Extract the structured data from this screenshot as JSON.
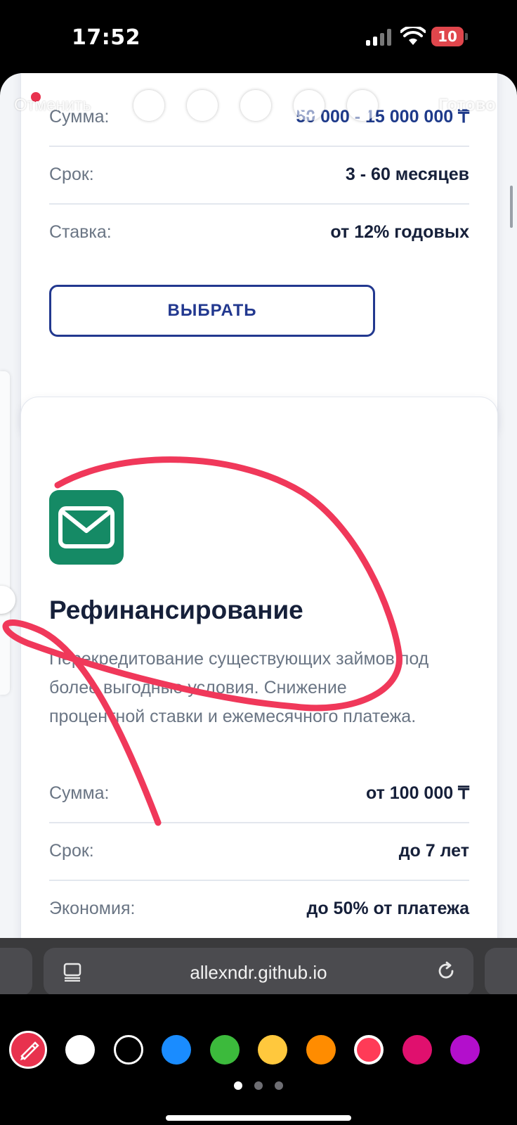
{
  "status_bar": {
    "time": "17:52",
    "battery": "10"
  },
  "markup_toolbar": {
    "cancel": "Отменить",
    "done": "Готово"
  },
  "card_loan": {
    "rows": [
      {
        "label": "Сумма:",
        "value": "50 000 - 15 000 000 ₸"
      },
      {
        "label": "Срок:",
        "value": "3 - 60 месяцев"
      },
      {
        "label": "Ставка:",
        "value": "от 12% годовых"
      }
    ],
    "button": "ВЫБРАТЬ"
  },
  "card_refinance": {
    "icon": "envelope-icon",
    "title": "Рефинансирование",
    "description": "Перекредитование существующих займов под более выгодные условия. Снижение процентной ставки и ежемесячного платежа.",
    "rows": [
      {
        "label": "Сумма:",
        "value": "от 100 000 ₸"
      },
      {
        "label": "Срок:",
        "value": "до 7 лет"
      },
      {
        "label": "Экономия:",
        "value": "до 50% от платежа"
      }
    ]
  },
  "browser": {
    "url": "allexndr.github.io"
  },
  "palette": {
    "colors": [
      "#ffffff",
      "#000000",
      "#1a8cff",
      "#3cba3c",
      "#ffc83d",
      "#ff8c00",
      "#ff3b57",
      "#e0106e",
      "#b30fcc"
    ],
    "selected": "#ff3b57"
  },
  "annotation": {
    "stroke_color": "#f0385a"
  }
}
